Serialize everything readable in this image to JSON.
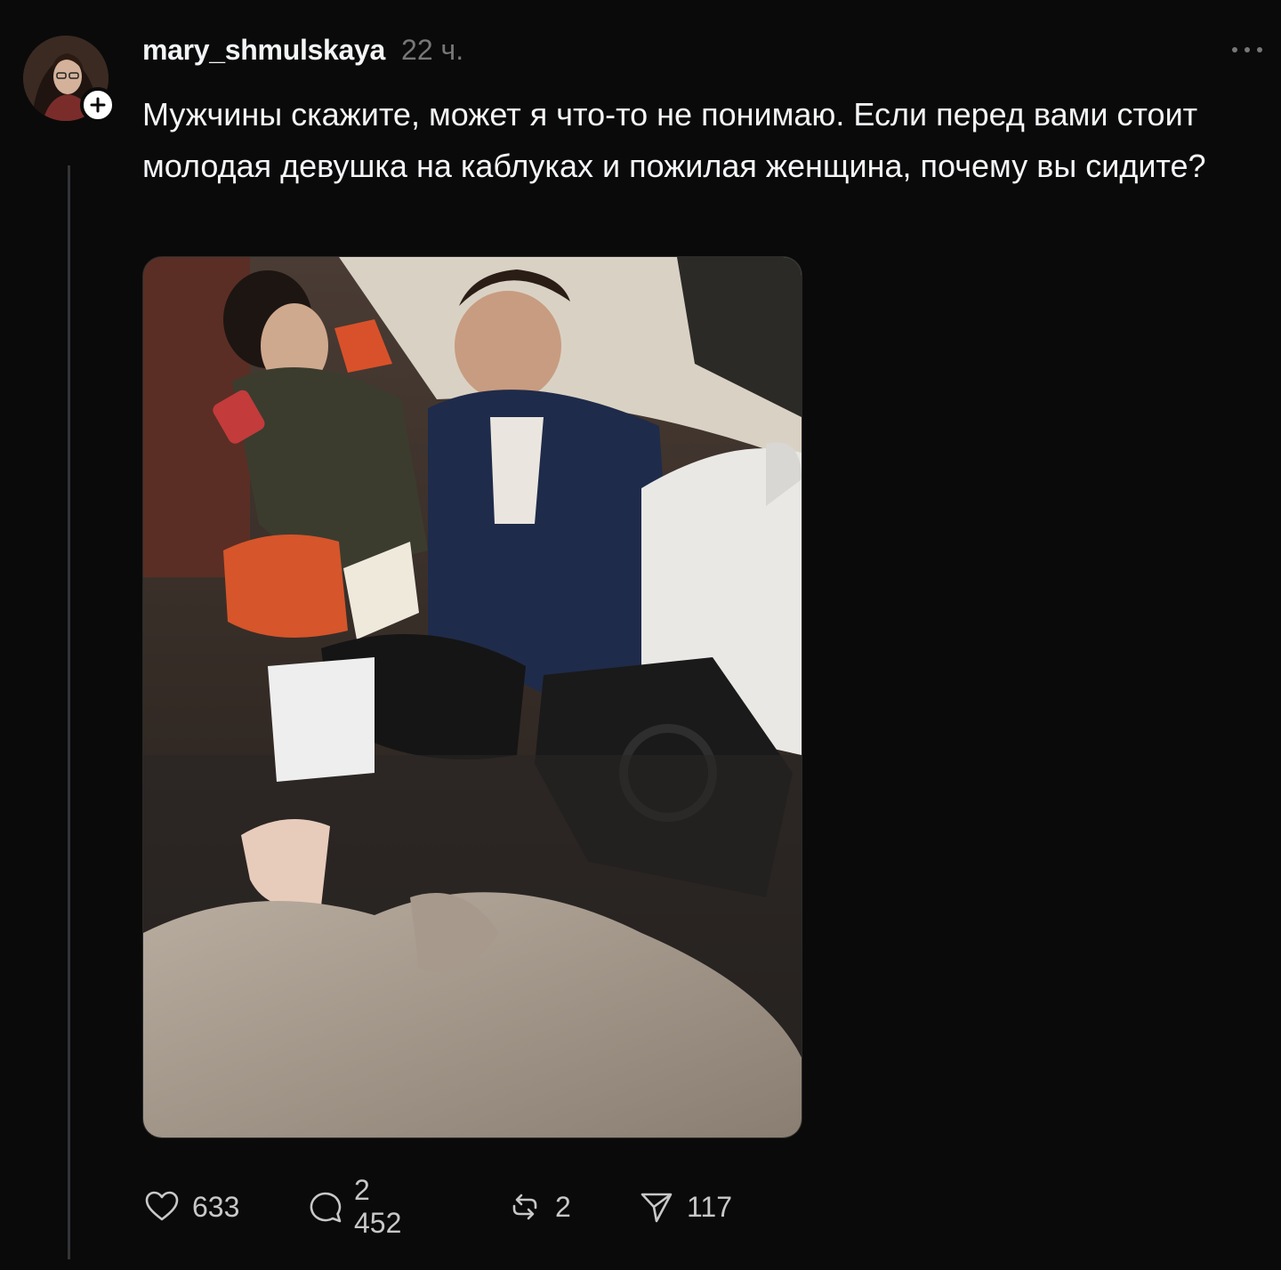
{
  "post": {
    "username": "mary_shmulskaya",
    "timestamp": "22 ч.",
    "text": "Мужчины скажите, может я что-то не понимаю. Если перед вами стоит молодая девушка на каблуках и пожилая женщина, почему вы сидите?",
    "icons": {
      "avatar": "avatar-photo",
      "follow": "plus-icon",
      "more": "more-horizontal-icon"
    }
  },
  "actions": {
    "likes": {
      "icon": "heart-icon",
      "count": "633"
    },
    "replies": {
      "icon": "comment-icon",
      "count": "2 452"
    },
    "reposts": {
      "icon": "repost-icon",
      "count": "2"
    },
    "shares": {
      "icon": "send-icon",
      "count": "117"
    }
  },
  "colors": {
    "background": "#0a0a0a",
    "text": "#f3f5f7",
    "muted": "#777777"
  }
}
